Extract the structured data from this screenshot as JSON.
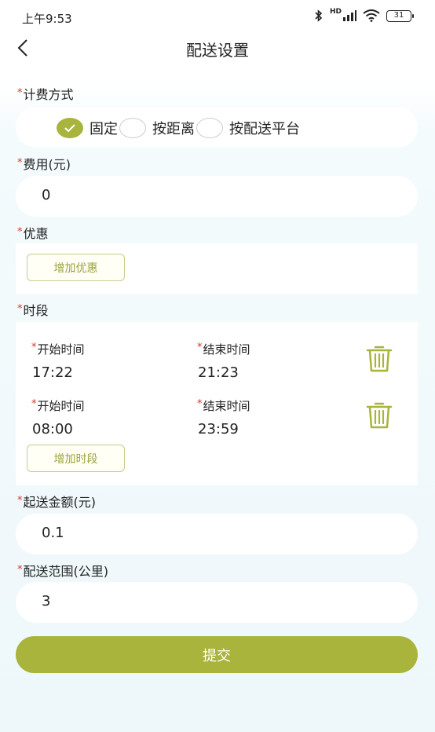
{
  "status_bar": {
    "time": "上午9:53",
    "network": "HD",
    "battery": "31"
  },
  "header": {
    "title": "配送设置"
  },
  "form": {
    "required_mark": "*",
    "billing": {
      "label": "计费方式",
      "options": [
        {
          "label": "固定",
          "checked": true
        },
        {
          "label": "按距离",
          "checked": false
        },
        {
          "label": "按配送平台",
          "checked": false
        }
      ]
    },
    "fee": {
      "label": "费用(元)",
      "value": "0"
    },
    "discount": {
      "label": "优惠",
      "add_label": "增加优惠"
    },
    "periods": {
      "label": "时段",
      "start_label": "开始时间",
      "end_label": "结束时间",
      "rows": [
        {
          "start": "17:22",
          "end": "21:23"
        },
        {
          "start": "08:00",
          "end": "23:59"
        }
      ],
      "add_label": "增加时段"
    },
    "min_amount": {
      "label": "起送金额(元)",
      "value": "0.1"
    },
    "range": {
      "label": "配送范围(公里)",
      "value": "3"
    },
    "submit_label": "提交"
  },
  "colors": {
    "accent": "#a8b43c",
    "required": "#d9342b"
  }
}
